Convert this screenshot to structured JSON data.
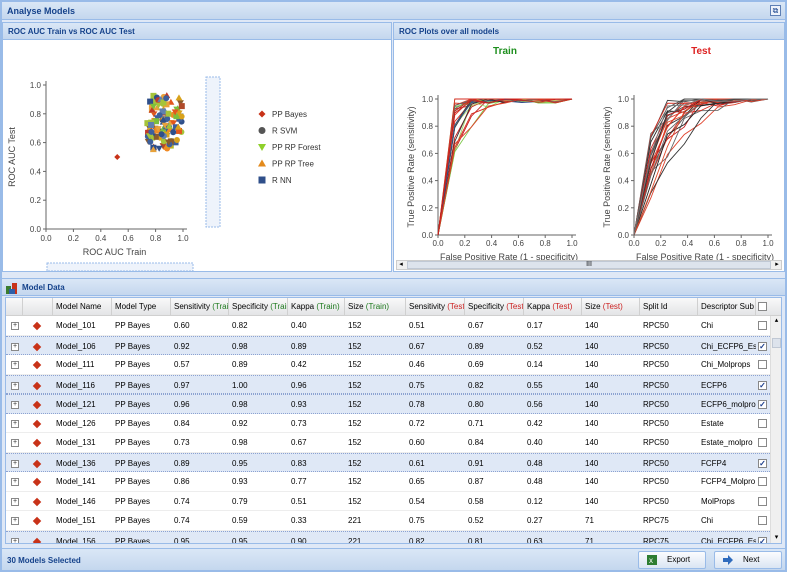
{
  "window": {
    "title": "Analyse Models",
    "tool_icon": "restore-icon"
  },
  "left_panel": {
    "title": "ROC AUC Train vs ROC AUC Test"
  },
  "right_panel": {
    "title": "ROC Plots over all models"
  },
  "scatter": {
    "ylabel": "ROC AUC Test",
    "xlabel": "ROC AUC Train",
    "ticks": [
      "0.0",
      "0.2",
      "0.4",
      "0.6",
      "0.8",
      "1.0"
    ],
    "yticks": [
      "0.0",
      "0.2",
      "0.4",
      "0.6",
      "0.8",
      "1.0"
    ],
    "legend": [
      "PP Bayes",
      "R SVM",
      "PP RP Forest",
      "PP RP Tree",
      "R NN"
    ]
  },
  "roc_train": {
    "title": "Train",
    "title_color": "#1e8f1e",
    "ylabel": "True Positive Rate (sensitivity)",
    "xlabel": "False Positive Rate (1 - specificity)",
    "ticks": [
      "0.0",
      "0.2",
      "0.4",
      "0.6",
      "0.8",
      "1.0"
    ]
  },
  "roc_test": {
    "title": "Test",
    "title_color": "#dd2222",
    "ylabel": "True Positive Rate (sensitivity)",
    "xlabel": "False Positive Rate (1 - specificity)",
    "ticks": [
      "0.0",
      "0.2",
      "0.4",
      "0.6",
      "0.8",
      "1.0"
    ]
  },
  "hscroll": {
    "grip": "III"
  },
  "data_panel": {
    "title": "Model Data",
    "icon": "grid-data-icon"
  },
  "columns": [
    {
      "label": "Model Name"
    },
    {
      "label": "Model Type"
    },
    {
      "label": "Sensitivity",
      "tag": "(Train)",
      "kind": "train"
    },
    {
      "label": "Specificity",
      "tag": "(Train)",
      "kind": "train"
    },
    {
      "label": "Kappa",
      "tag": "(Train)",
      "kind": "train"
    },
    {
      "label": "Size",
      "tag": "(Train)",
      "kind": "train"
    },
    {
      "label": "Sensitivity",
      "tag": "(Test)",
      "kind": "test"
    },
    {
      "label": "Specificity",
      "tag": "(Test)",
      "kind": "test"
    },
    {
      "label": "Kappa",
      "tag": "(Test)",
      "kind": "test"
    },
    {
      "label": "Size",
      "tag": "(Test)",
      "kind": "test"
    },
    {
      "label": "Split Id"
    },
    {
      "label": "Descriptor Sub"
    }
  ],
  "rows": [
    {
      "name": "Model_101",
      "type": "PP Bayes",
      "sens_tr": "0.60",
      "spec_tr": "0.82",
      "kap_tr": "0.40",
      "size_tr": "152",
      "sens_te": "0.51",
      "spec_te": "0.67",
      "kap_te": "0.17",
      "size_te": "140",
      "split": "RPC50",
      "desc": "Chi",
      "checked": false,
      "selected": false
    },
    {
      "name": "Model_106",
      "type": "PP Bayes",
      "sens_tr": "0.92",
      "spec_tr": "0.98",
      "kap_tr": "0.89",
      "size_tr": "152",
      "sens_te": "0.67",
      "spec_te": "0.89",
      "kap_te": "0.52",
      "size_te": "140",
      "split": "RPC50",
      "desc": "Chi_ECFP6_Es",
      "checked": true,
      "selected": true
    },
    {
      "name": "Model_111",
      "type": "PP Bayes",
      "sens_tr": "0.57",
      "spec_tr": "0.89",
      "kap_tr": "0.42",
      "size_tr": "152",
      "sens_te": "0.46",
      "spec_te": "0.69",
      "kap_te": "0.14",
      "size_te": "140",
      "split": "RPC50",
      "desc": "Chi_Molprops",
      "checked": false,
      "selected": false
    },
    {
      "name": "Model_116",
      "type": "PP Bayes",
      "sens_tr": "0.97",
      "spec_tr": "1.00",
      "kap_tr": "0.96",
      "size_tr": "152",
      "sens_te": "0.75",
      "spec_te": "0.82",
      "kap_te": "0.55",
      "size_te": "140",
      "split": "RPC50",
      "desc": "ECFP6",
      "checked": true,
      "selected": true
    },
    {
      "name": "Model_121",
      "type": "PP Bayes",
      "sens_tr": "0.96",
      "spec_tr": "0.98",
      "kap_tr": "0.93",
      "size_tr": "152",
      "sens_te": "0.78",
      "spec_te": "0.80",
      "kap_te": "0.56",
      "size_te": "140",
      "split": "RPC50",
      "desc": "ECFP6_molpro",
      "checked": true,
      "selected": true
    },
    {
      "name": "Model_126",
      "type": "PP Bayes",
      "sens_tr": "0.84",
      "spec_tr": "0.92",
      "kap_tr": "0.73",
      "size_tr": "152",
      "sens_te": "0.72",
      "spec_te": "0.71",
      "kap_te": "0.42",
      "size_te": "140",
      "split": "RPC50",
      "desc": "Estate",
      "checked": false,
      "selected": false
    },
    {
      "name": "Model_131",
      "type": "PP Bayes",
      "sens_tr": "0.73",
      "spec_tr": "0.98",
      "kap_tr": "0.67",
      "size_tr": "152",
      "sens_te": "0.60",
      "spec_te": "0.84",
      "kap_te": "0.40",
      "size_te": "140",
      "split": "RPC50",
      "desc": "Estate_molpro",
      "checked": false,
      "selected": false
    },
    {
      "name": "Model_136",
      "type": "PP Bayes",
      "sens_tr": "0.89",
      "spec_tr": "0.95",
      "kap_tr": "0.83",
      "size_tr": "152",
      "sens_te": "0.61",
      "spec_te": "0.91",
      "kap_te": "0.48",
      "size_te": "140",
      "split": "RPC50",
      "desc": "FCFP4",
      "checked": true,
      "selected": true
    },
    {
      "name": "Model_141",
      "type": "PP Bayes",
      "sens_tr": "0.86",
      "spec_tr": "0.93",
      "kap_tr": "0.77",
      "size_tr": "152",
      "sens_te": "0.65",
      "spec_te": "0.87",
      "kap_te": "0.48",
      "size_te": "140",
      "split": "RPC50",
      "desc": "FCFP4_Molpro",
      "checked": false,
      "selected": false
    },
    {
      "name": "Model_146",
      "type": "PP Bayes",
      "sens_tr": "0.74",
      "spec_tr": "0.79",
      "kap_tr": "0.51",
      "size_tr": "152",
      "sens_te": "0.54",
      "spec_te": "0.58",
      "kap_te": "0.12",
      "size_te": "140",
      "split": "RPC50",
      "desc": "MolProps",
      "checked": false,
      "selected": false
    },
    {
      "name": "Model_151",
      "type": "PP Bayes",
      "sens_tr": "0.74",
      "spec_tr": "0.59",
      "kap_tr": "0.33",
      "size_tr": "221",
      "sens_te": "0.75",
      "spec_te": "0.52",
      "kap_te": "0.27",
      "size_te": "71",
      "split": "RPC75",
      "desc": "Chi",
      "checked": false,
      "selected": false
    },
    {
      "name": "Model_156",
      "type": "PP Bayes",
      "sens_tr": "0.95",
      "spec_tr": "0.95",
      "kap_tr": "0.90",
      "size_tr": "221",
      "sens_te": "0.82",
      "spec_te": "0.81",
      "kap_te": "0.63",
      "size_te": "71",
      "split": "RPC75",
      "desc": "Chi_ECFP6_Es",
      "checked": true,
      "selected": true
    }
  ],
  "footer": {
    "status": "30 Models Selected",
    "export_label": "Export",
    "next_label": "Next"
  }
}
